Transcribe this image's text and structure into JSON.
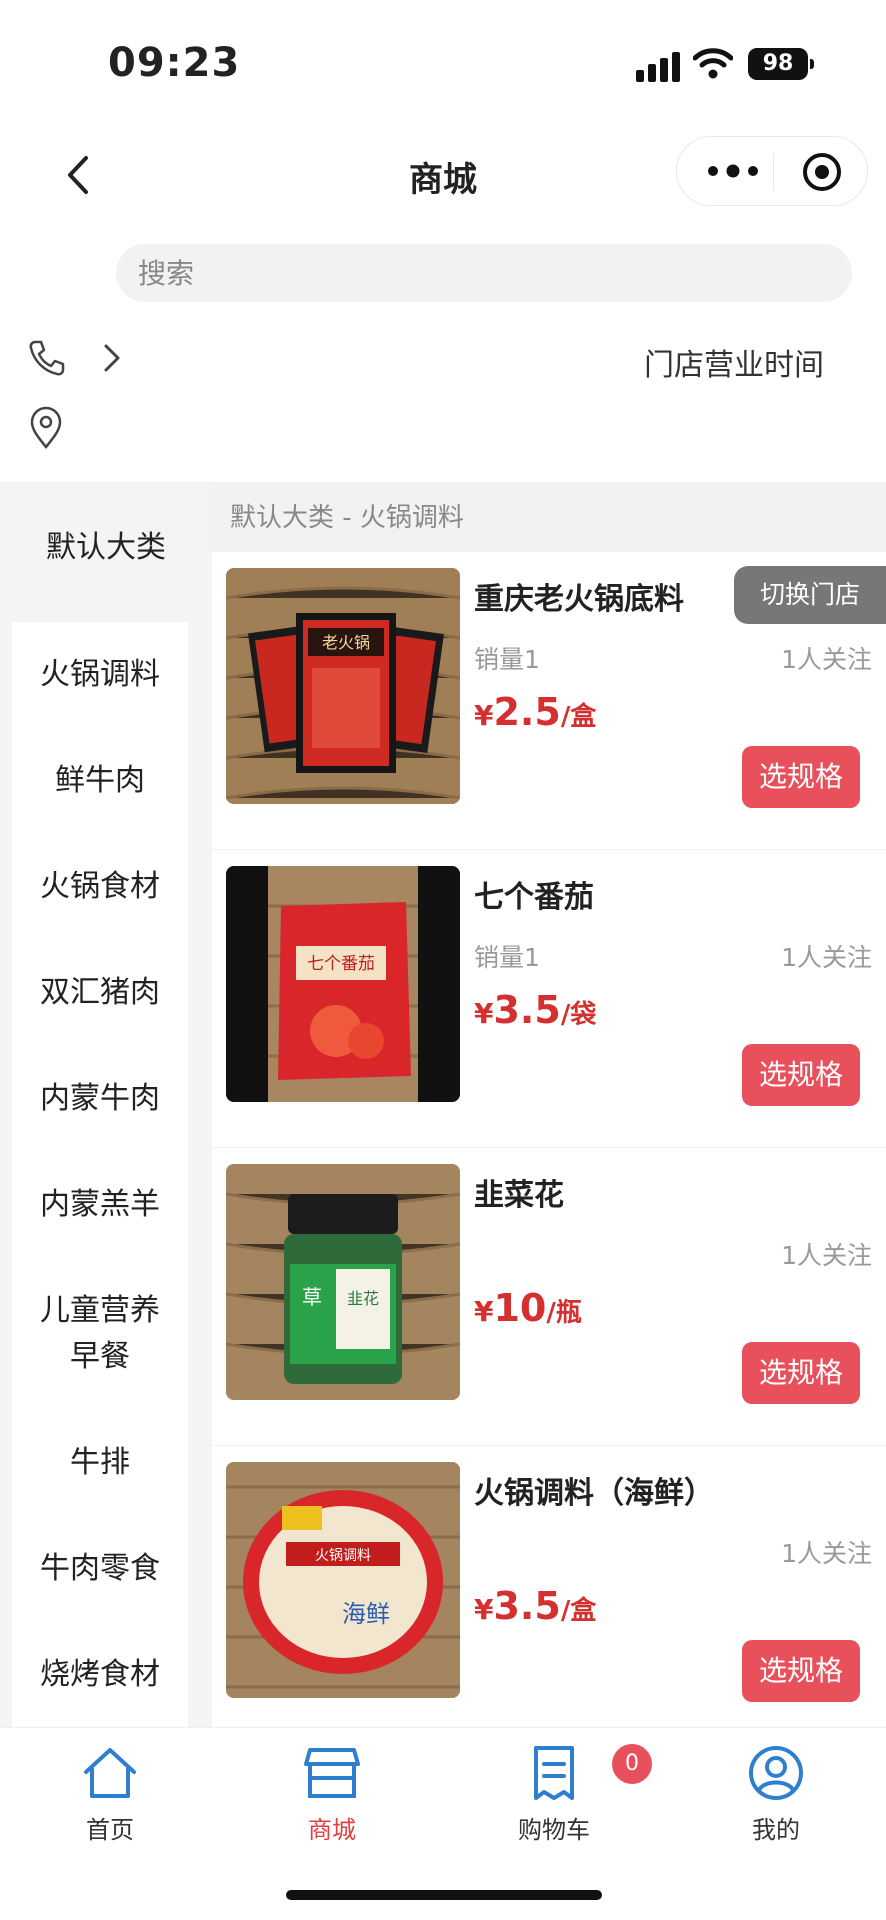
{
  "status": {
    "time": "09:23",
    "battery": "98"
  },
  "nav": {
    "title": "商城"
  },
  "search": {
    "placeholder": "搜索"
  },
  "store": {
    "hours_label": "门店营业时间",
    "switch_label": "切换门店"
  },
  "categories": {
    "top": "默认大类",
    "items": [
      "火锅调料",
      "鲜牛肉",
      "火锅食材",
      "双汇猪肉",
      "内蒙牛肉",
      "内蒙羔羊",
      "儿童营养\n早餐",
      "牛排",
      "牛肉零食",
      "烧烤食材"
    ]
  },
  "breadcrumb": "默认大类 - 火锅调料",
  "products": [
    {
      "name": "重庆老火锅底料",
      "sales": "销量1",
      "follow": "1人关注",
      "currency": "¥",
      "price": "2.5",
      "unit": "/盒",
      "button": "选规格"
    },
    {
      "name": "七个番茄",
      "sales": "销量1",
      "follow": "1人关注",
      "currency": "¥",
      "price": "3.5",
      "unit": "/袋",
      "button": "选规格"
    },
    {
      "name": "韭菜花",
      "sales": "",
      "follow": "1人关注",
      "currency": "¥",
      "price": "10",
      "unit": "/瓶",
      "button": "选规格"
    },
    {
      "name": "火锅调料（海鲜）",
      "sales": "",
      "follow": "1人关注",
      "currency": "¥",
      "price": "3.5",
      "unit": "/盒",
      "button": "选规格"
    }
  ],
  "tabbar": {
    "home": "首页",
    "mall": "商城",
    "cart": "购物车",
    "cart_badge": "0",
    "mine": "我的"
  },
  "colors": {
    "accent": "#e8505b",
    "price": "#d43030",
    "tab_blue": "#2f7fd0"
  }
}
